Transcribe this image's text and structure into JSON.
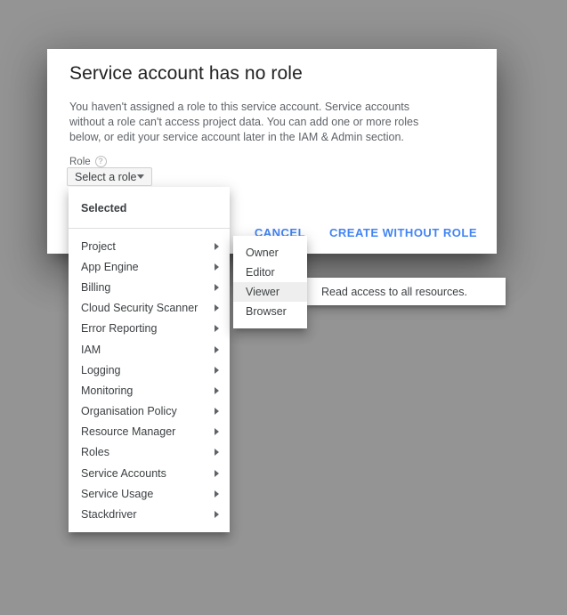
{
  "dialog": {
    "title": "Service account has no role",
    "body": "You haven't assigned a role to this service account. Service accounts without a role can't access project data. You can add one or more roles below, or edit your service account later in the IAM & Admin section.",
    "field_label": "Role",
    "help_icon_glyph": "?",
    "select_value": "Select a role",
    "cancel_label": "CANCEL",
    "create_label": "CREATE WITHOUT ROLE",
    "accent_color": "#4285f4"
  },
  "menu": {
    "section_header": "Selected",
    "items": [
      {
        "label": "Project"
      },
      {
        "label": "App Engine"
      },
      {
        "label": "Billing"
      },
      {
        "label": "Cloud Security Scanner"
      },
      {
        "label": "Error Reporting"
      },
      {
        "label": "IAM"
      },
      {
        "label": "Logging"
      },
      {
        "label": "Monitoring"
      },
      {
        "label": "Organisation Policy"
      },
      {
        "label": "Resource Manager"
      },
      {
        "label": "Roles"
      },
      {
        "label": "Service Accounts"
      },
      {
        "label": "Service Usage"
      },
      {
        "label": "Stackdriver"
      }
    ]
  },
  "submenu": {
    "items": [
      {
        "label": "Owner",
        "highlighted": false
      },
      {
        "label": "Editor",
        "highlighted": false
      },
      {
        "label": "Viewer",
        "highlighted": true
      },
      {
        "label": "Browser",
        "highlighted": false
      }
    ]
  },
  "tooltip": {
    "text": "Read access to all resources."
  },
  "page": {
    "background_color": "#949494"
  }
}
